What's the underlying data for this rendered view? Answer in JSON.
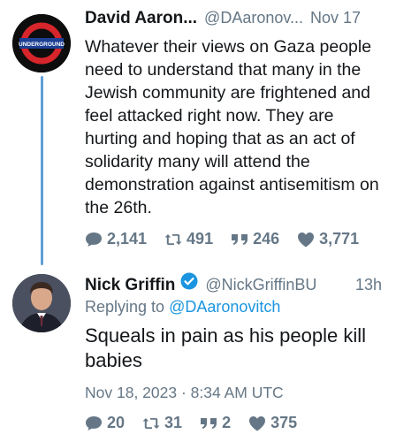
{
  "tweets": [
    {
      "name": "David Aaron...",
      "handle": "@DAaronov...",
      "time": "Nov 17",
      "text": "Whatever their views on Gaza people need to understand that many in the Jewish community are frightened and feel attacked right now. They are hurting and hoping that as an act of solidarity many will attend the demonstration against antisemitism on the 26th.",
      "replies": "2,141",
      "retweets": "491",
      "quotes": "246",
      "likes": "3,771",
      "avatar_text": "UNDERGROUND"
    },
    {
      "name": "Nick Griffin",
      "handle": "@NickGriffinBU",
      "time": "13h",
      "verified": true,
      "replying_prefix": "Replying to",
      "replying_handle": "@DAaronovitch",
      "text": "Squeals in pain as his people kill babies",
      "timestamp": "Nov 18, 2023 · 8:34 AM UTC",
      "replies": "20",
      "retweets": "31",
      "quotes": "2",
      "likes": "375"
    }
  ],
  "colors": {
    "accent": "#1b95e0",
    "thread_line": "#5f9fd6",
    "muted": "#657786"
  },
  "icons": [
    "reply-icon",
    "retweet-icon",
    "quote-icon",
    "heart-icon",
    "verified-icon"
  ]
}
